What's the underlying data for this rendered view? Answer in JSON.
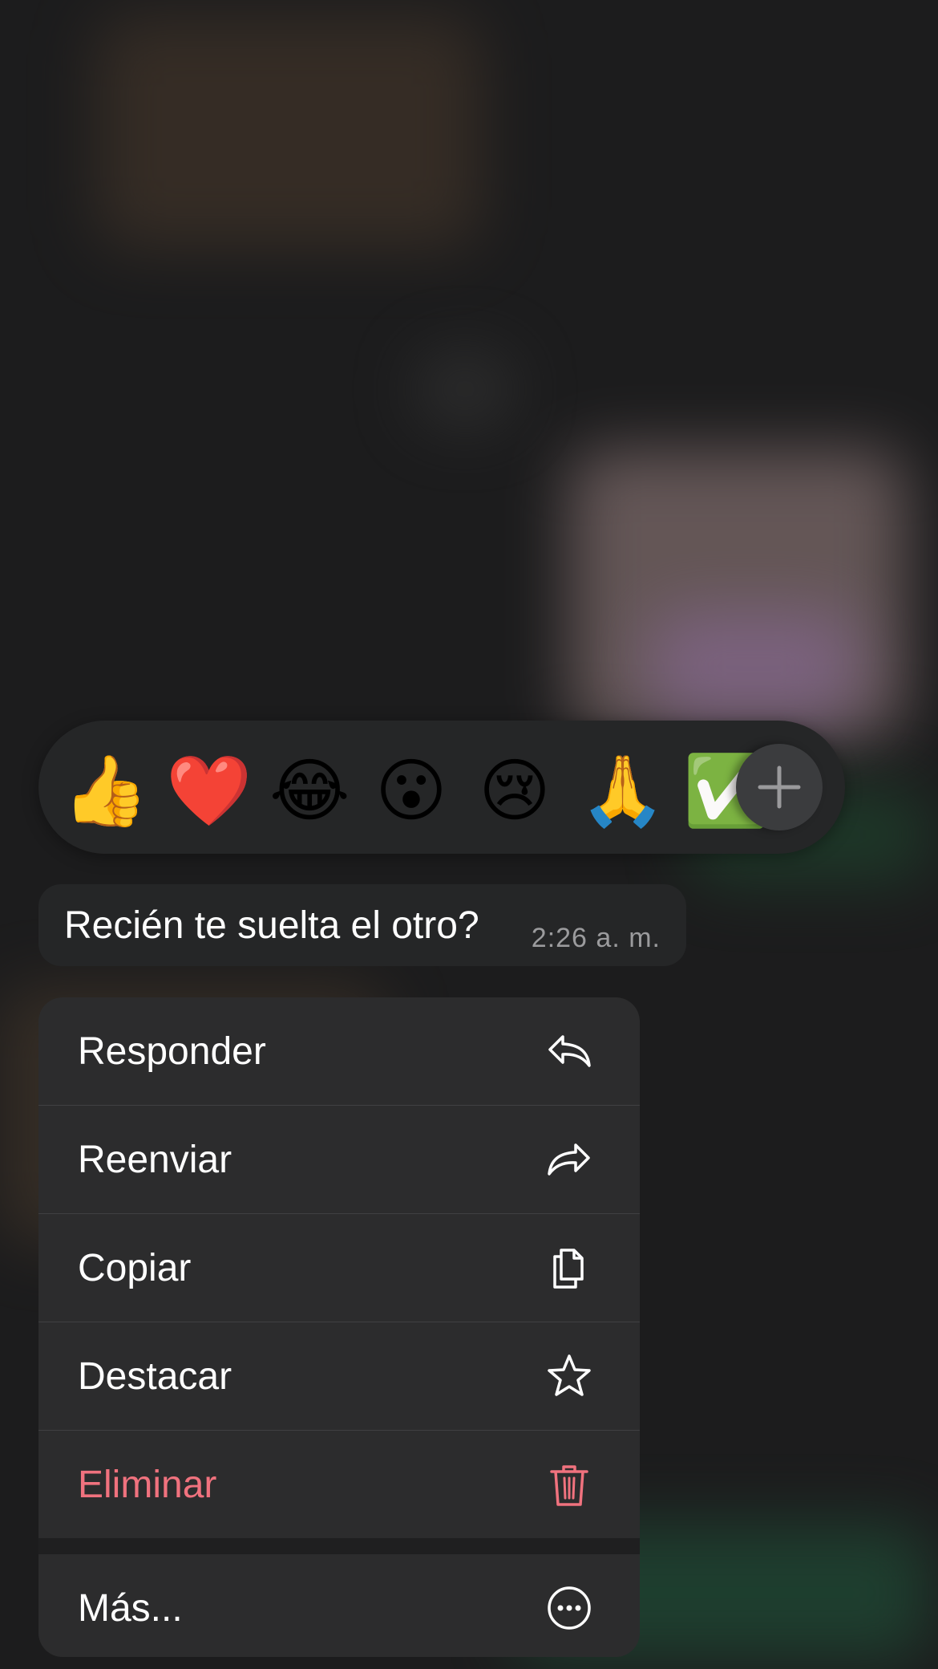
{
  "reactions": {
    "emojis": [
      {
        "name": "thumbs-up",
        "glyph": "👍"
      },
      {
        "name": "red-heart",
        "glyph": "❤️"
      },
      {
        "name": "joy",
        "glyph": "😂"
      },
      {
        "name": "open-mouth",
        "glyph": "😮"
      },
      {
        "name": "crying",
        "glyph": "😢"
      },
      {
        "name": "folded-hands",
        "glyph": "🙏"
      },
      {
        "name": "check-mark-button",
        "glyph": "✅"
      }
    ],
    "add_icon": "plus-icon"
  },
  "message": {
    "text": "Recién te suelta el otro?",
    "time": "2:26 a. m."
  },
  "menu": {
    "items": [
      {
        "label": "Responder",
        "icon": "reply-icon"
      },
      {
        "label": "Reenviar",
        "icon": "forward-icon"
      },
      {
        "label": "Copiar",
        "icon": "copy-icon"
      },
      {
        "label": "Destacar",
        "icon": "star-icon"
      },
      {
        "label": "Eliminar",
        "icon": "trash-icon",
        "color": "#f0727e"
      }
    ],
    "more": {
      "label": "Más...",
      "icon": "more-icon"
    }
  }
}
